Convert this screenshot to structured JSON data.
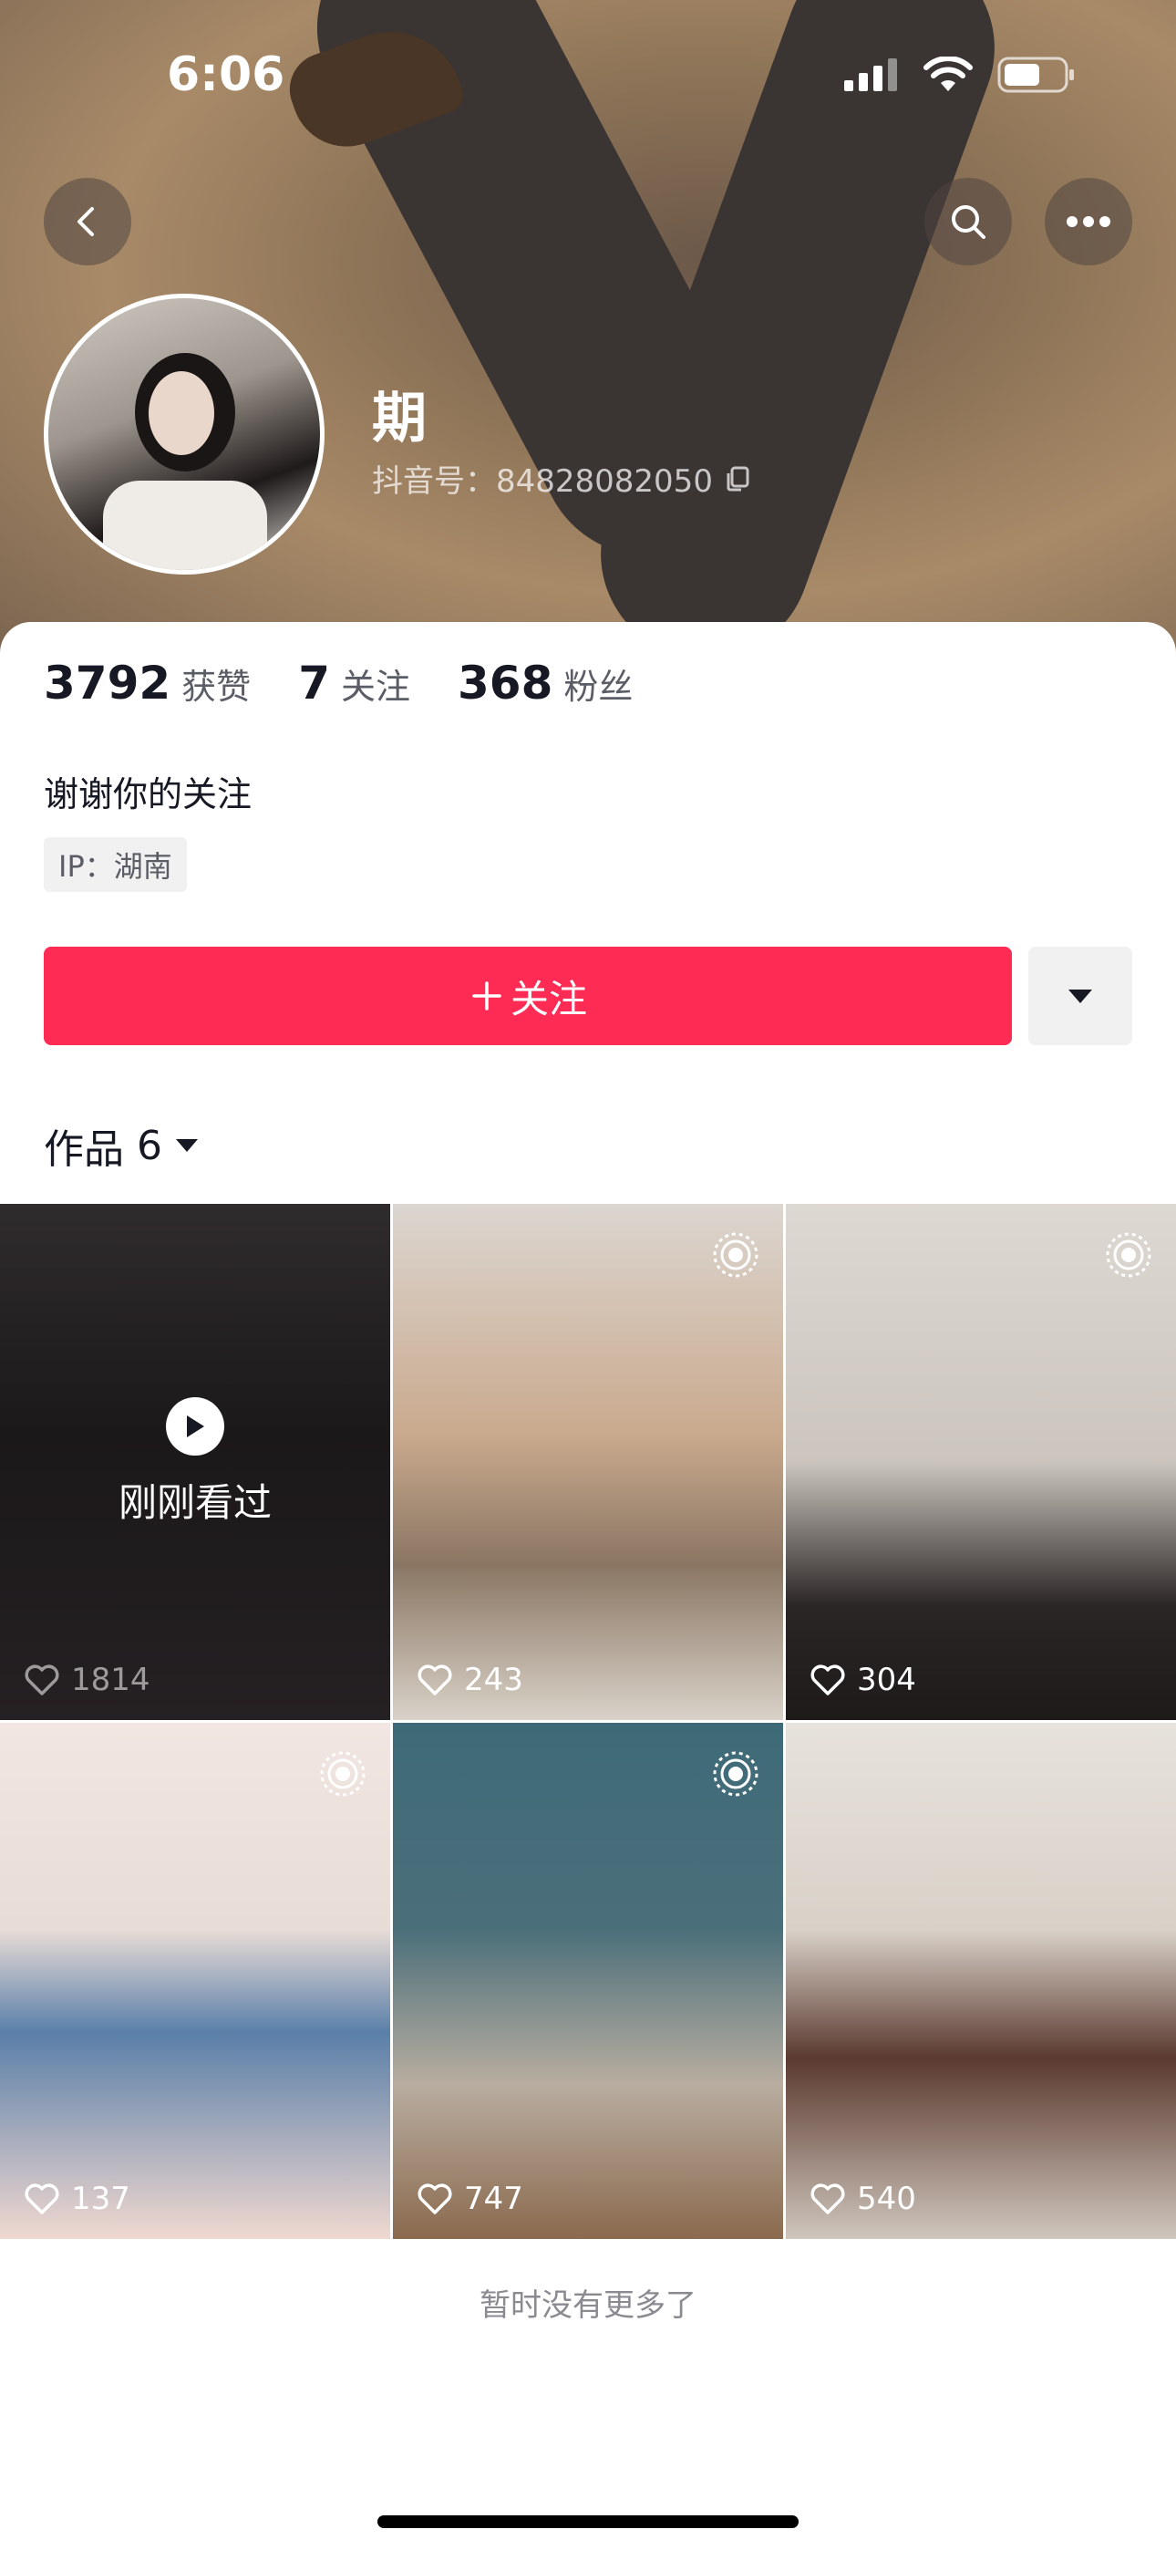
{
  "status_bar": {
    "time": "6:06"
  },
  "profile": {
    "name": "期",
    "douyin_id": "抖音号：84828082050",
    "bio": "谢谢你的关注",
    "ip": "IP：湖南"
  },
  "stats": [
    {
      "num": "3792",
      "label": "获赞"
    },
    {
      "num": "7",
      "label": "关注"
    },
    {
      "num": "368",
      "label": "粉丝"
    }
  ],
  "actions": {
    "follow": "关注"
  },
  "works": {
    "label": "作品",
    "count": "6",
    "watched_label": "刚刚看过",
    "items": [
      {
        "likes": "1814",
        "watched": true,
        "live": false
      },
      {
        "likes": "243",
        "watched": false,
        "live": true
      },
      {
        "likes": "304",
        "watched": false,
        "live": true
      },
      {
        "likes": "137",
        "watched": false,
        "live": true
      },
      {
        "likes": "747",
        "watched": false,
        "live": true
      },
      {
        "likes": "540",
        "watched": false,
        "live": false
      }
    ]
  },
  "footer": {
    "no_more": "暂时没有更多了"
  },
  "colors": {
    "accent": "#fe2c55",
    "text": "#161823",
    "secondary": "#5b5d66"
  },
  "icons": [
    "back-icon",
    "search-icon",
    "more-icon",
    "copy-icon",
    "plus-icon",
    "caret-down-icon",
    "heart-icon",
    "live-icon",
    "play-icon"
  ]
}
